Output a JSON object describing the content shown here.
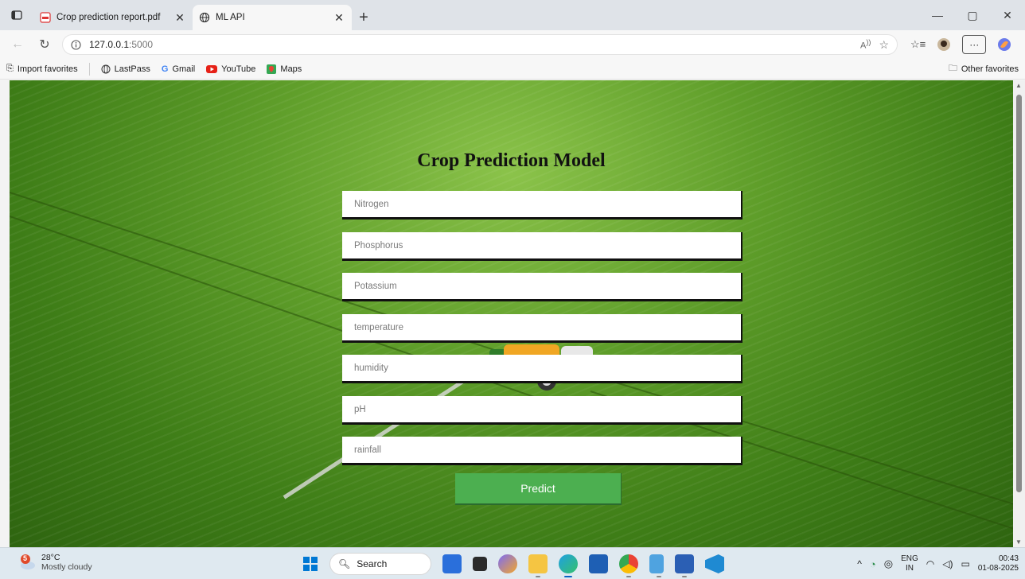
{
  "browser": {
    "tabs": [
      {
        "title": "Crop prediction report.pdf",
        "icon": "pdf-icon",
        "active": false
      },
      {
        "title": "ML API",
        "icon": "globe-icon",
        "active": true
      }
    ],
    "address": {
      "host": "127.0.0.1",
      "port": ":5000"
    },
    "bookmarks": [
      {
        "label": "Import favorites",
        "icon": "import-icon"
      },
      {
        "label": "LastPass",
        "icon": "globe-icon"
      },
      {
        "label": "Gmail",
        "icon": "google-icon"
      },
      {
        "label": "YouTube",
        "icon": "youtube-icon"
      },
      {
        "label": "Maps",
        "icon": "maps-icon"
      }
    ],
    "other_favorites": "Other favorites"
  },
  "page": {
    "title": "Crop Prediction Model",
    "fields": [
      {
        "name": "nitrogen",
        "placeholder": "Nitrogen"
      },
      {
        "name": "phosphorus",
        "placeholder": "Phosphorus"
      },
      {
        "name": "potassium",
        "placeholder": "Potassium"
      },
      {
        "name": "temperature",
        "placeholder": "temperature"
      },
      {
        "name": "humidity",
        "placeholder": "humidity"
      },
      {
        "name": "ph",
        "placeholder": "pH"
      },
      {
        "name": "rainfall",
        "placeholder": "rainfall"
      }
    ],
    "submit_label": "Predict",
    "colors": {
      "button": "#4caf50",
      "field_bg": "#ffffff",
      "title": "#111111"
    }
  },
  "taskbar": {
    "weather": {
      "badge": "5",
      "temp": "28°C",
      "condition": "Mostly cloudy"
    },
    "search_label": "Search",
    "apps": [
      "meet-icon",
      "terminal-icon",
      "copilot-icon",
      "folder-icon",
      "edge-icon",
      "store-icon",
      "chrome-icon",
      "notepad-icon",
      "word-icon",
      "vscode-icon"
    ],
    "lang": {
      "line1": "ENG",
      "line2": "IN"
    },
    "clock": {
      "time": "00:43",
      "date": "01-08-2025"
    }
  }
}
